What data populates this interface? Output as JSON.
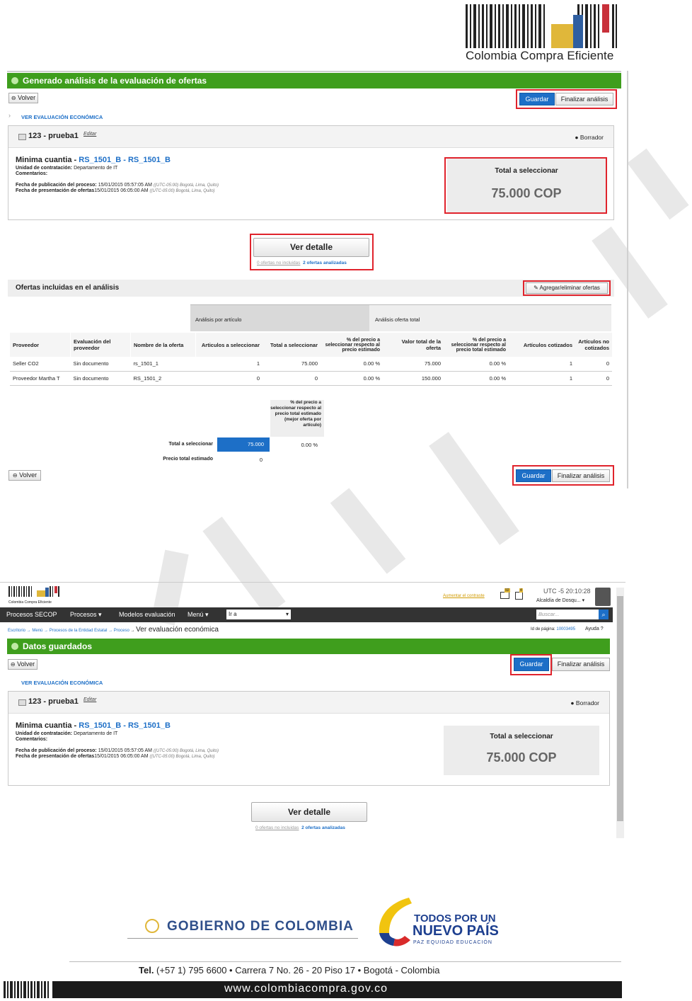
{
  "brand": {
    "name": "Colombia Compra Eficiente",
    "small_name": "Colombia Compra Eficiente"
  },
  "shot1": {
    "banner": "Generado análisis de la evaluación de ofertas",
    "back": "Volver",
    "save": "Guardar",
    "finish": "Finalizar análisis",
    "section_link": "VER EVALUACIÓN ECONÓMICA",
    "proc_title": "123 - prueba1",
    "edit": "Editar",
    "status": "Borrador",
    "type": "Minima cuantia - ",
    "refs": "RS_1501_B - RS_1501_B",
    "unit_label": "Unidad de contratación:",
    "unit_value": " Departamento de IT",
    "comments_label": "Comentarios:",
    "pub_label": "Fecha de publicación del proceso:",
    "pub_value": " 15/01/2015 05:57:05 AM ",
    "pub_tz": "((UTC-05:00) Bogotá, Lima, Quito)",
    "pres_label": "Fecha de presentación de ofertas",
    "pres_value": "15/01/2015 06:05:00 AM ",
    "pres_tz": "((UTC-05:00) Bogotá, Lima, Quito)",
    "total_label": "Total a seleccionar",
    "total_value": "75.000 COP",
    "detail": "Ver detalle",
    "not_included": "0 ofertas no incluidas",
    "analyzed": "2 ofertas analizadas",
    "offers_title": "Ofertas incluidas en el análisis",
    "add_remove": "Agregar/eliminar ofertas",
    "group1": "Análisis por artículo",
    "group2": "Análisis oferta total",
    "columns": [
      "Proveedor",
      "Evaluación del proveedor",
      "Nombre de la oferta",
      "Articulos a seleccionar",
      "Total a seleccionar",
      "% del precio a seleccionar respecto al precio estimado",
      "Valor total de la oferta",
      "% del precio a seleccionar respecto al precio total estimado",
      "Artículos cotizados",
      "Artículos no cotizados"
    ],
    "rows": [
      [
        "Seller CO2",
        "Sin documento",
        "rs_1501_1",
        "1",
        "75.000",
        "0.00 %",
        "75.000",
        "0.00 %",
        "1",
        "0"
      ],
      [
        "Proveedor Martha T",
        "Sin documento",
        "RS_1501_2",
        "0",
        "0",
        "0.00 %",
        "150.000",
        "0.00 %",
        "1",
        "0"
      ]
    ],
    "summary_header": "% del precio a seleccionar respecto al precio total estimado (mejor oferta por artículo)",
    "summary_total_label": "Total a seleccionar",
    "summary_total_value": "75.000",
    "summary_total_pct": "0.00 %",
    "summary_est_label": "Precio total estimado",
    "summary_est_value": "0"
  },
  "shot2": {
    "increase_contrast": "Aumentar el contraste",
    "badge1": "92",
    "badge2": "4",
    "clock": "UTC -5 20:10:28",
    "entity": "Alcaldía de Dosqu...",
    "nav": [
      "Procesos SECOP",
      "Procesos",
      "Modelos evaluación",
      "Menú"
    ],
    "goto": "Ir a",
    "search_placeholder": "Buscar...",
    "breadcrumb": [
      "Escritorio",
      "Menú",
      "Procesos de la Entidad Estatal",
      "Proceso"
    ],
    "page_title": "Ver evaluación económica",
    "page_id_label": "Id de página:",
    "page_id": "10003495",
    "help": "Ayuda",
    "banner": "Datos guardados"
  },
  "footer": {
    "gov": "GOBIERNO DE COLOMBIA",
    "slogan1": "TODOS POR UN",
    "slogan2": "NUEVO PAÍS",
    "slogan3": "PAZ  EQUIDAD  EDUCACIÓN",
    "tel_label": "Tel.",
    "address": " (+57 1) 795 6600 • Carrera 7 No. 26 - 20 Piso 17 • Bogotá - Colombia",
    "url": "www.colombiacompra.gov.co"
  },
  "colors": {
    "green": "#3f9e1d",
    "blue": "#1d6fc7",
    "red": "#e0232c"
  }
}
